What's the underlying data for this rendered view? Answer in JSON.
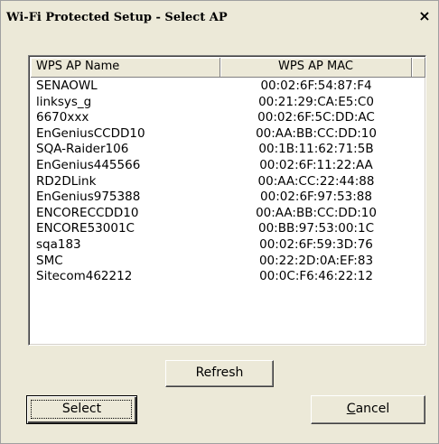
{
  "window": {
    "title": "Wi-Fi Protected Setup - Select AP",
    "close_glyph": "×"
  },
  "list": {
    "columns": [
      "WPS AP Name",
      "WPS AP MAC",
      ""
    ],
    "rows": [
      {
        "name": "SENAOWL",
        "mac": "00:02:6F:54:87:F4"
      },
      {
        "name": "linksys_g",
        "mac": "00:21:29:CA:E5:C0"
      },
      {
        "name": "6670xxx",
        "mac": "00:02:6F:5C:DD:AC"
      },
      {
        "name": "EnGeniusCCDD10",
        "mac": "00:AA:BB:CC:DD:10"
      },
      {
        "name": "SQA-Raider106",
        "mac": "00:1B:11:62:71:5B"
      },
      {
        "name": "EnGenius445566",
        "mac": "00:02:6F:11:22:AA"
      },
      {
        "name": "RD2DLink",
        "mac": "00:AA:CC:22:44:88"
      },
      {
        "name": "EnGenius975388",
        "mac": "00:02:6F:97:53:88"
      },
      {
        "name": "ENCORECCDD10",
        "mac": "00:AA:BB:CC:DD:10"
      },
      {
        "name": "ENCORE53001C",
        "mac": "00:BB:97:53:00:1C"
      },
      {
        "name": "sqa183",
        "mac": "00:02:6F:59:3D:76"
      },
      {
        "name": "SMC",
        "mac": "00:22:2D:0A:EF:83"
      },
      {
        "name": "Sitecom462212",
        "mac": "00:0C:F6:46:22:12"
      }
    ]
  },
  "buttons": {
    "refresh": "Refresh",
    "select": "Select",
    "cancel_mnemonic": "C",
    "cancel_rest": "ancel"
  }
}
